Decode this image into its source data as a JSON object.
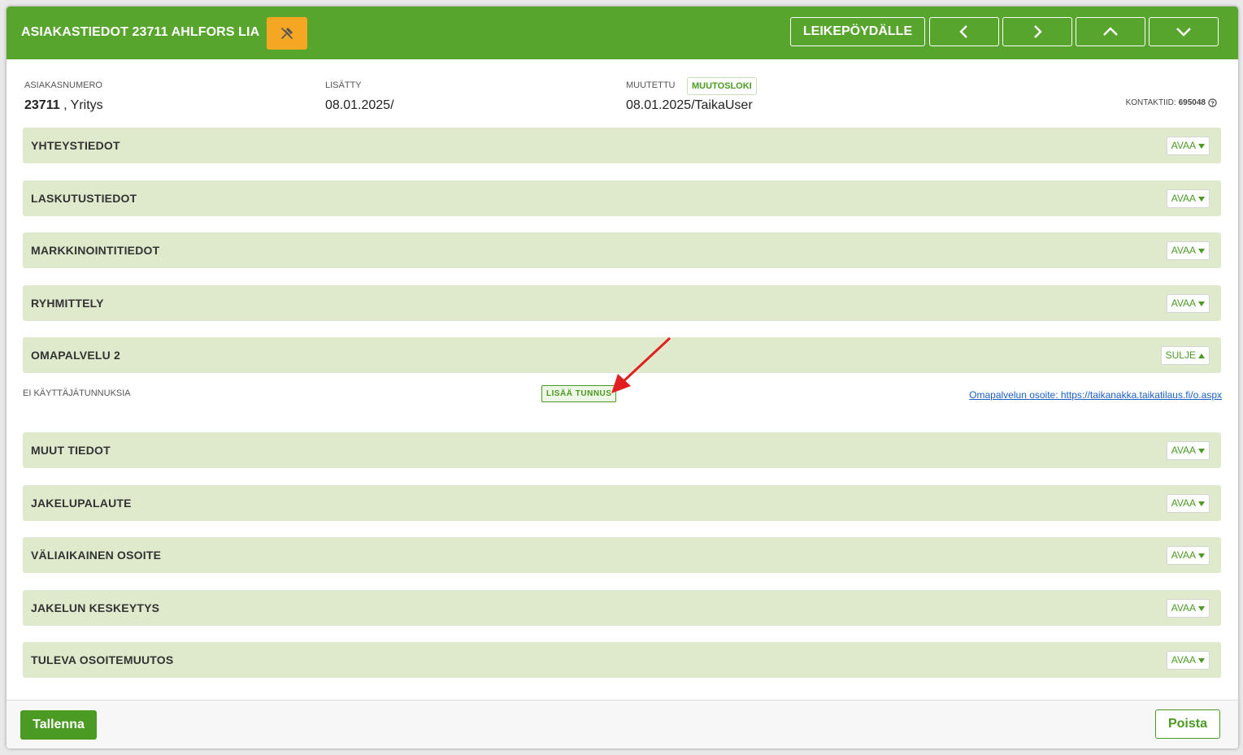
{
  "header": {
    "title": "ASIAKASTIEDOT 23711 AHLFORS LIA",
    "clipboard_label": "LEIKEPÖYDÄLLE",
    "pin_icon": "pin-off-icon",
    "nav_icons": [
      "chevron-left-icon",
      "chevron-right-icon",
      "chevron-up-icon",
      "chevron-down-icon"
    ]
  },
  "meta": {
    "customer_number_label": "ASIAKASNUMERO",
    "customer_number": "23711",
    "customer_type": ", Yritys",
    "added_label": "LISÄTTY",
    "added_value": "08.01.2025/",
    "modified_label": "MUUTETTU",
    "changelog_badge": "MUUTOSLOKI",
    "modified_value": "08.01.2025/TaikaUser",
    "contact_id_label": "KONTAKTIID:",
    "contact_id": "695048"
  },
  "sections": [
    {
      "title": "YHTEYSTIEDOT",
      "button": "AVAA"
    },
    {
      "title": "LASKUTUSTIEDOT",
      "button": "AVAA"
    },
    {
      "title": "MARKKINOINTITIEDOT",
      "button": "AVAA"
    },
    {
      "title": "RYHMITTELY",
      "button": "AVAA"
    },
    {
      "title": "OMAPALVELU 2",
      "button": "SULJE"
    },
    {
      "title": "MUUT TIEDOT",
      "button": "AVAA"
    },
    {
      "title": "JAKELUPALAUTE",
      "button": "AVAA"
    },
    {
      "title": "VÄLIAIKAINEN OSOITE",
      "button": "AVAA"
    },
    {
      "title": "JAKELUN KESKEYTYS",
      "button": "AVAA"
    },
    {
      "title": "TULEVA OSOITEMUUTOS",
      "button": "AVAA"
    }
  ],
  "omapalvelu": {
    "no_users": "EI KÄYTTÄJÄTUNNUKSIA",
    "add_button": "LISÄÄ TUNNUS",
    "link": "Omapalvelun osoite: https://taikanakka.taikatilaus.fi/o.aspx"
  },
  "footer": {
    "save": "Tallenna",
    "delete": "Poista"
  },
  "colors": {
    "header_bg": "#58a52e",
    "accent": "#4a9a23",
    "pin_button": "#f5a623",
    "section_bg": "#dfeacd",
    "annotation_arrow": "#e02020"
  }
}
